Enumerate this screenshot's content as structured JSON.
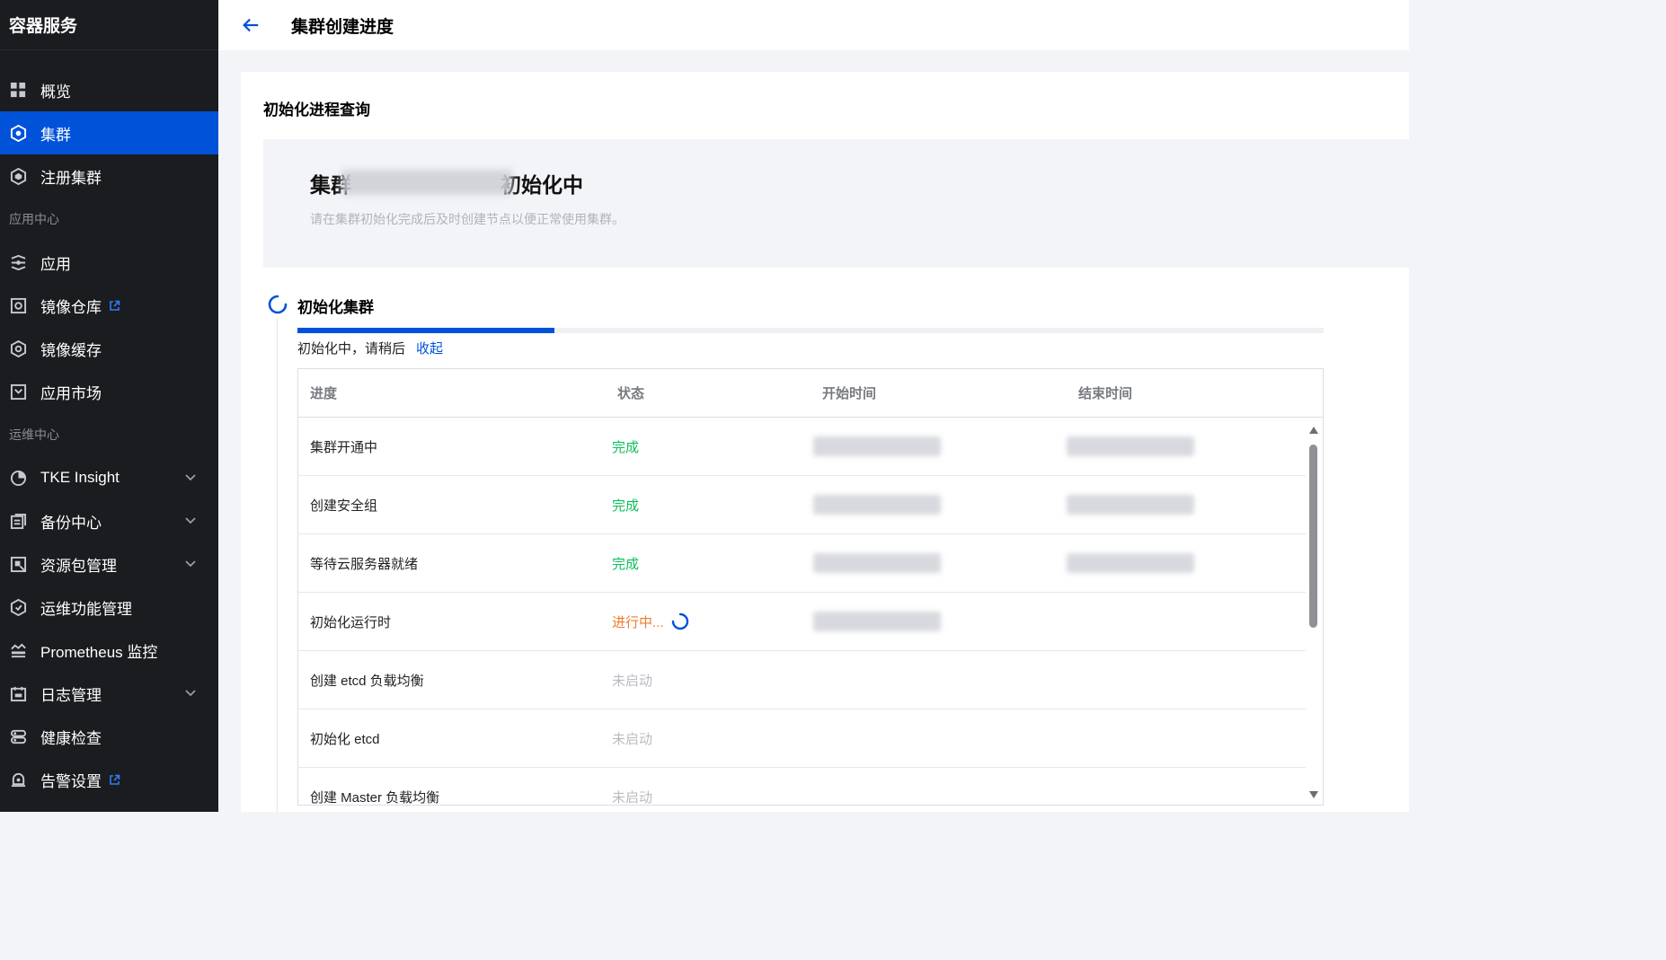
{
  "sidebar": {
    "brand": "容器服务",
    "items": [
      {
        "label": "概览",
        "icon": "grid-icon"
      },
      {
        "label": "集群",
        "icon": "cluster-icon"
      },
      {
        "label": "注册集群",
        "icon": "register-cluster-icon"
      }
    ],
    "section_app": "应用中心",
    "app_items": [
      {
        "label": "应用",
        "icon": "app-icon"
      },
      {
        "label": "镜像仓库",
        "icon": "image-repo-icon"
      },
      {
        "label": "镜像缓存",
        "icon": "image-cache-icon"
      },
      {
        "label": "应用市场",
        "icon": "app-market-icon"
      }
    ],
    "section_ops": "运维中心",
    "ops_items": [
      {
        "label": "TKE Insight",
        "icon": "pie-icon"
      },
      {
        "label": "备份中心",
        "icon": "backup-icon"
      },
      {
        "label": "资源包管理",
        "icon": "resource-pack-icon"
      },
      {
        "label": "运维功能管理",
        "icon": "ops-feature-icon"
      },
      {
        "label": "Prometheus 监控",
        "icon": "monitor-icon"
      },
      {
        "label": "日志管理",
        "icon": "log-icon"
      },
      {
        "label": "健康检查",
        "icon": "health-check-icon"
      },
      {
        "label": "告警设置",
        "icon": "alarm-icon"
      }
    ],
    "active_color": "#0052d9"
  },
  "header": {
    "title": "集群创建进度"
  },
  "main": {
    "card_title": "初始化进程查询",
    "banner": {
      "title_prefix": "集群",
      "title_suffix": "初始化中",
      "subtitle": "请在集群初始化完成后及时创建节点以便正常使用集群。"
    },
    "step": {
      "title": "初始化集群",
      "progress_percent": 25,
      "status_text": "初始化中，请稍后",
      "collapse_label": "收起"
    },
    "table": {
      "columns": [
        "进度",
        "状态",
        "开始时间",
        "结束时间"
      ],
      "rows": [
        {
          "step": "集群开通中",
          "status": "完成"
        },
        {
          "step": "创建安全组",
          "status": "完成"
        },
        {
          "step": "等待云服务器就绪",
          "status": "完成"
        },
        {
          "step": "初始化运行时",
          "status": "进行中..."
        },
        {
          "step": "创建 etcd 负载均衡",
          "status": "未启动"
        },
        {
          "step": "初始化 etcd",
          "status": "未启动"
        },
        {
          "step": "创建 Master 负载均衡",
          "status": "未启动"
        }
      ]
    }
  }
}
